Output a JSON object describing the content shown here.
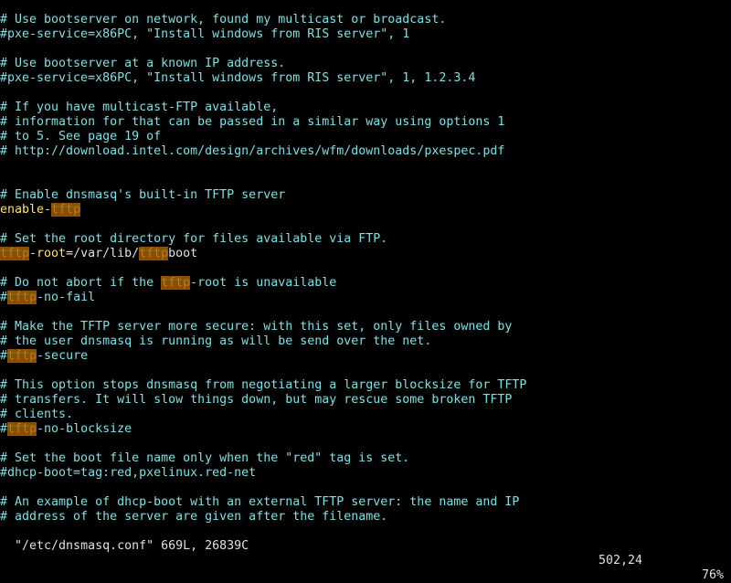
{
  "lines": [
    [
      {
        "t": "# Use bootserver on network, found my multicast or broadcast.",
        "c": "c"
      }
    ],
    [
      {
        "t": "#pxe-service=x86PC, \"Install windows from RIS server\", 1",
        "c": "c"
      }
    ],
    [],
    [
      {
        "t": "# Use bootserver at a known IP address.",
        "c": "c"
      }
    ],
    [
      {
        "t": "#pxe-service=x86PC, \"Install windows from RIS server\", 1, 1.2.3.4",
        "c": "c"
      }
    ],
    [],
    [
      {
        "t": "# If you have multicast-FTP available,",
        "c": "c"
      }
    ],
    [
      {
        "t": "# information for that can be passed in a similar way using options 1",
        "c": "c"
      }
    ],
    [
      {
        "t": "# to 5. See page 19 of",
        "c": "c"
      }
    ],
    [
      {
        "t": "# http://download.intel.com/design/archives/wfm/downloads/pxespec.pdf",
        "c": "c"
      }
    ],
    [],
    [],
    [
      {
        "t": "# Enable dnsmasq's built-in TFTP server",
        "c": "c"
      }
    ],
    [
      {
        "t": "enable-",
        "c": "o"
      },
      {
        "t": "tftp",
        "c": "h"
      }
    ],
    [],
    [
      {
        "t": "# Set the root directory for files available via FTP.",
        "c": "c"
      }
    ],
    [
      {
        "t": "tftp",
        "c": "h"
      },
      {
        "t": "-root",
        "c": "o"
      },
      {
        "t": "=/var/lib/",
        "c": "p"
      },
      {
        "t": "tftp",
        "c": "h"
      },
      {
        "t": "boot",
        "c": "p"
      }
    ],
    [],
    [
      {
        "t": "# Do not abort if the ",
        "c": "c"
      },
      {
        "t": "tftp",
        "c": "h"
      },
      {
        "t": "-root is unavailable",
        "c": "c"
      }
    ],
    [
      {
        "t": "#",
        "c": "c"
      },
      {
        "t": "tftp",
        "c": "h"
      },
      {
        "t": "-no-fail",
        "c": "c"
      }
    ],
    [],
    [
      {
        "t": "# Make the TFTP server more secure: with this set, only files owned by",
        "c": "c"
      }
    ],
    [
      {
        "t": "# the user dnsmasq is running as will be send over the net.",
        "c": "c"
      }
    ],
    [
      {
        "t": "#",
        "c": "c"
      },
      {
        "t": "tftp",
        "c": "h"
      },
      {
        "t": "-secure",
        "c": "c"
      }
    ],
    [],
    [
      {
        "t": "# This option stops dnsmasq from negotiating a larger blocksize for TFTP",
        "c": "c"
      }
    ],
    [
      {
        "t": "# transfers. It will slow things down, but may rescue some broken TFTP",
        "c": "c"
      }
    ],
    [
      {
        "t": "# clients.",
        "c": "c"
      }
    ],
    [
      {
        "t": "#",
        "c": "c"
      },
      {
        "t": "tftp",
        "c": "h"
      },
      {
        "t": "-no-blocksize",
        "c": "c"
      }
    ],
    [],
    [
      {
        "t": "# Set the boot file name only when the \"red\" tag is set.",
        "c": "c"
      }
    ],
    [
      {
        "t": "#dhcp-boot=tag:red,pxelinux.red-net",
        "c": "c"
      }
    ],
    [],
    [
      {
        "t": "# An example of dhcp-boot with an external TFTP server: the name and IP",
        "c": "c"
      }
    ],
    [
      {
        "t": "# address of the server are given after the filename.",
        "c": "c"
      }
    ]
  ],
  "status": {
    "file_info": "\"/etc/dnsmasq.conf\" 669L, 26839C",
    "position": "502,24",
    "percent": "76%"
  }
}
